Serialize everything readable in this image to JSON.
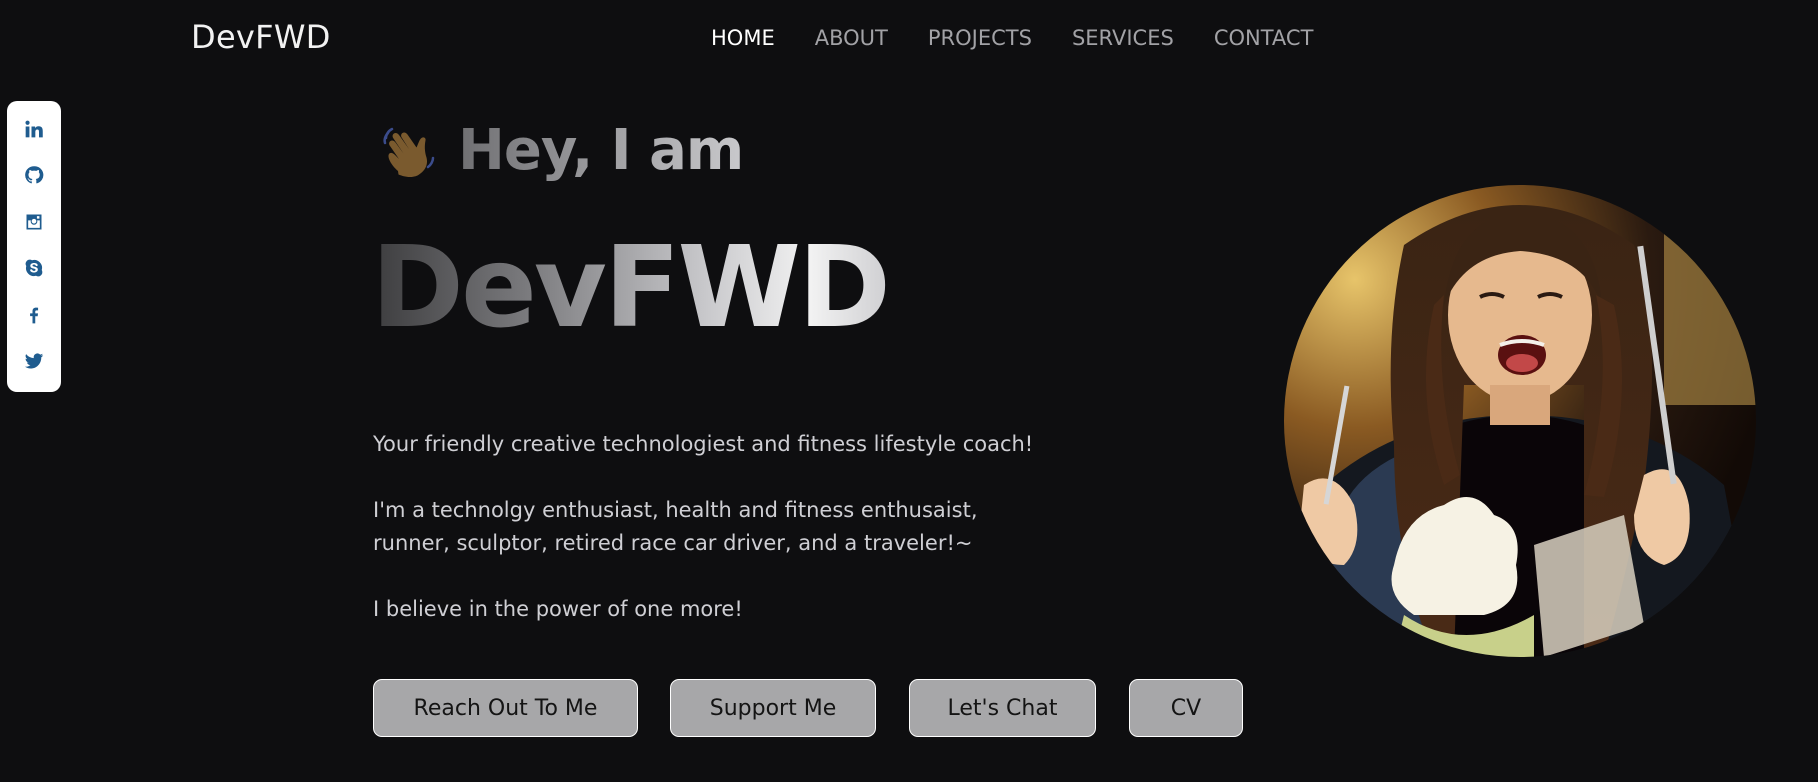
{
  "header": {
    "brand": "DevFWD",
    "nav": [
      {
        "label": "HOME",
        "active": true
      },
      {
        "label": "ABOUT",
        "active": false
      },
      {
        "label": "PROJECTS",
        "active": false
      },
      {
        "label": "SERVICES",
        "active": false
      },
      {
        "label": "CONTACT",
        "active": false
      }
    ]
  },
  "social": {
    "icons": [
      "linkedin-icon",
      "github-icon",
      "instagram-icon",
      "skype-icon",
      "facebook-icon",
      "twitter-icon"
    ],
    "icon_color": "#1f5c8f",
    "background": "#ffffff"
  },
  "hero": {
    "wave_icon": "waving-hand-icon",
    "greeting": "Hey, I am",
    "name": "DevFWD",
    "bio": [
      "Your friendly creative technologiest and fitness lifestyle coach!",
      "I'm a technolgy enthusiast, health and fitness enthusaist, runner, sculptor, retired race car driver, and a traveler!~",
      "I believe in the power of one more!"
    ],
    "buttons": [
      "Reach Out To Me",
      "Support Me",
      "Let's Chat",
      "CV"
    ]
  },
  "colors": {
    "background": "#0e0e10",
    "button_bg": "#a7a7a9",
    "nav_active": "#ffffff",
    "nav_inactive": "#a2a2a6"
  }
}
